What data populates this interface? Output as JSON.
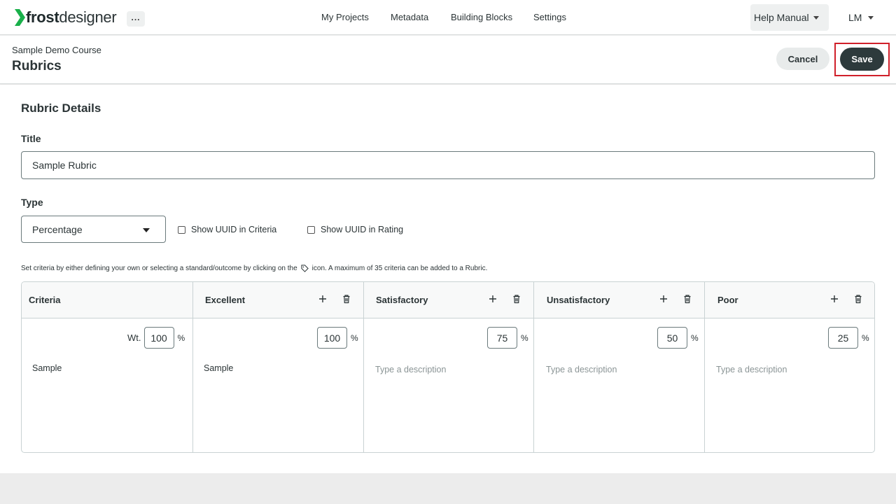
{
  "app": {
    "logo_bold": "frost",
    "logo_light": "designer",
    "more_label": "..."
  },
  "nav": {
    "links": [
      "My Projects",
      "Metadata",
      "Building Blocks",
      "Settings"
    ],
    "help_label": "Help Manual",
    "user_label": "LM"
  },
  "header": {
    "breadcrumb": "Sample Demo Course",
    "title": "Rubrics",
    "cancel_label": "Cancel",
    "save_label": "Save"
  },
  "details": {
    "section_title": "Rubric Details",
    "title_label": "Title",
    "title_value": "Sample Rubric",
    "type_label": "Type",
    "type_value": "Percentage",
    "show_uuid_criteria": "Show UUID in Criteria",
    "show_uuid_rating": "Show UUID in Rating",
    "hint_before": "Set criteria by either defining your own or selecting a standard/outcome by clicking on the",
    "hint_after": "icon. A maximum of 35 criteria can be added to a Rubric."
  },
  "rubric": {
    "criteria_header": "Criteria",
    "weight_label": "Wt.",
    "weight_value": "100",
    "percent_symbol": "%",
    "criteria_text": "Sample",
    "levels": [
      {
        "name": "Excellent",
        "value": "100",
        "description": "Sample",
        "placeholder": false
      },
      {
        "name": "Satisfactory",
        "value": "75",
        "description": "Type a description",
        "placeholder": true
      },
      {
        "name": "Unsatisfactory",
        "value": "50",
        "description": "Type a description",
        "placeholder": true
      },
      {
        "name": "Poor",
        "value": "25",
        "description": "Type a description",
        "placeholder": true
      }
    ]
  },
  "colors": {
    "save_bg": "#2d3a3c",
    "highlight": "#d0202a",
    "logo_accent": "#19b04a"
  }
}
